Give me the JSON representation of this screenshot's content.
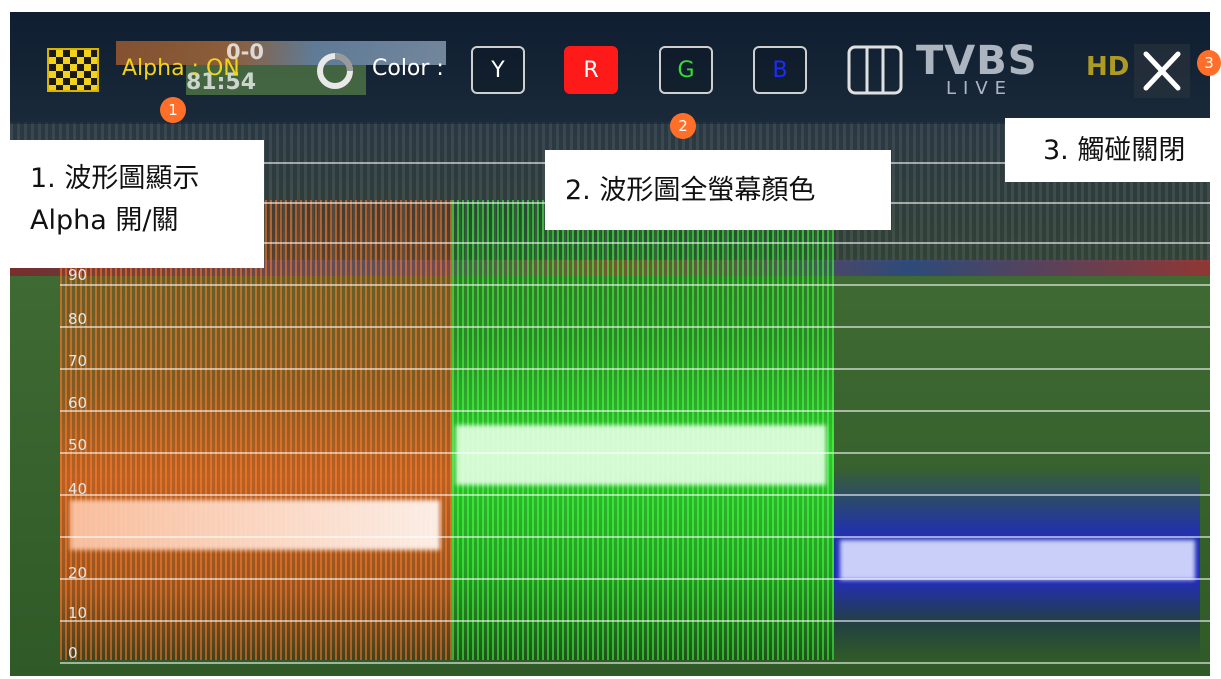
{
  "toolbar": {
    "alpha_label": "Alpha : ON",
    "color_label": "Color :",
    "channels": [
      "Y",
      "R",
      "G",
      "B"
    ],
    "active_channel": "R",
    "channel_colors": {
      "Y": "#ffffff",
      "R": "#ff1a1a",
      "G": "#33dd33",
      "B": "#1a2cff"
    },
    "icons": {
      "alpha": "checkerboard-icon",
      "color": "color-wheel-icon",
      "layout": "column-layout-icon",
      "close": "close-icon"
    }
  },
  "broadcast": {
    "score": "0-0",
    "clock": "81:54",
    "channel_logo": "TVBS",
    "channel_sub": "LIVE",
    "hd_logo": "HD"
  },
  "badges": [
    "1",
    "2",
    "3"
  ],
  "annotations": {
    "note1_line1": "1. 波形圖顯示",
    "note1_line2": "Alpha 開/關",
    "note2": "2. 波形圖全螢幕顏色",
    "note3": "3. 觸碰關閉"
  },
  "scale": {
    "ticks": [
      "90",
      "80",
      "70",
      "60",
      "50",
      "40",
      "20",
      "10",
      "0"
    ]
  }
}
